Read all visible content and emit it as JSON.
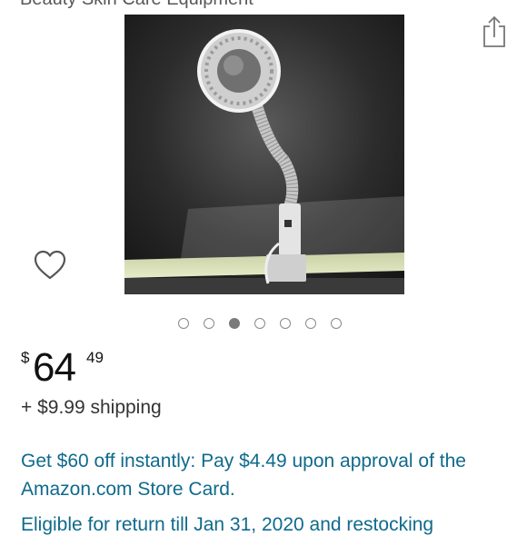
{
  "product": {
    "subtitle": "Beauty Skin Care Equipment",
    "image_alt": "Clamp-on LED magnifying lamp",
    "carousel": {
      "count": 7,
      "active_index": 3
    }
  },
  "price": {
    "currency_symbol": "$",
    "whole": "64",
    "fraction": "49"
  },
  "shipping": "+ $9.99 shipping",
  "promo": "Get $60 off instantly: Pay $4.49 upon approval of the Amazon.com Store Card.",
  "return_policy": "Eligible for return till Jan 31, 2020 and restocking",
  "icons": {
    "share": "share-icon",
    "wishlist": "heart-icon"
  },
  "colors": {
    "link": "#0f6a8c",
    "dot_active": "#7a7a7a"
  }
}
